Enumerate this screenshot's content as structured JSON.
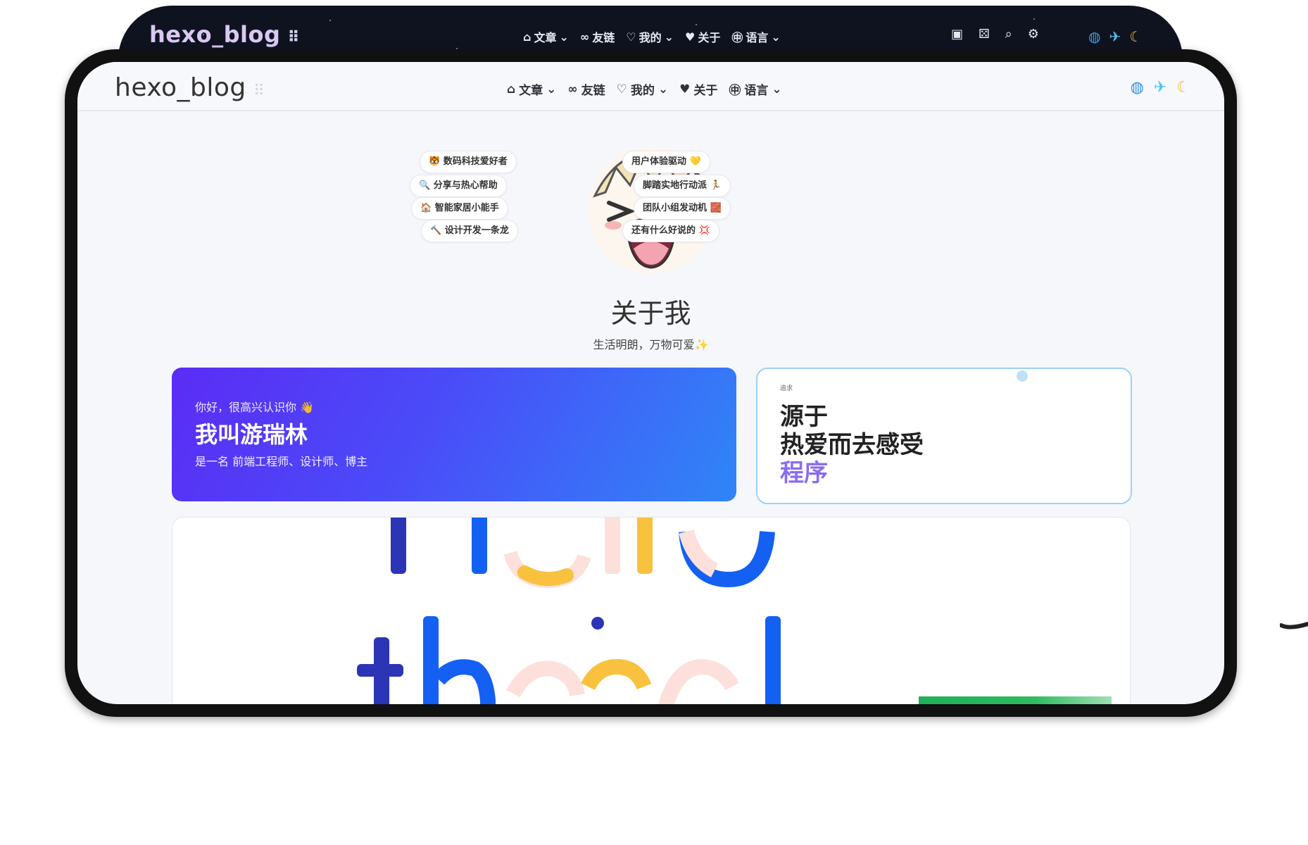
{
  "back_window": {
    "site_title": "hexo_blog",
    "menu": [
      {
        "icon": "home-icon",
        "glyph": "⌂",
        "label": "文章",
        "has_dropdown": true
      },
      {
        "icon": "link-icon",
        "glyph": "∞",
        "label": "友链",
        "has_dropdown": false
      },
      {
        "icon": "heart-pulse-icon",
        "glyph": "♡",
        "label": "我的",
        "has_dropdown": true
      },
      {
        "icon": "heart-icon",
        "glyph": "♥",
        "label": "关于",
        "has_dropdown": false
      },
      {
        "icon": "language-icon",
        "glyph": "㊥",
        "label": "语言",
        "has_dropdown": true
      }
    ]
  },
  "topbar": {
    "site_title": "hexo_blog",
    "menu": [
      {
        "icon": "home-icon",
        "glyph": "⌂",
        "label": "文章",
        "has_dropdown": true
      },
      {
        "icon": "link-icon",
        "glyph": "∞",
        "label": "友链",
        "has_dropdown": false
      },
      {
        "icon": "heart-pulse-icon",
        "glyph": "♡",
        "label": "我的",
        "has_dropdown": true
      },
      {
        "icon": "heart-icon",
        "glyph": "♥",
        "label": "关于",
        "has_dropdown": false
      },
      {
        "icon": "language-icon",
        "glyph": "㊥",
        "label": "语言",
        "has_dropdown": true
      }
    ],
    "mood_icons": [
      "globe-icon",
      "airplane-icon",
      "moon-icon"
    ]
  },
  "about": {
    "tags_left": [
      "数码科技爱好者",
      "分享与热心帮助",
      "智能家居小能手",
      "设计开发一条龙"
    ],
    "tags_right": [
      "用户体验驱动",
      "脚踏实地行动派",
      "团队小组发动机",
      "还有什么好说的"
    ],
    "title": "关于我",
    "subtitle": "生活明朗，万物可爱"
  },
  "hello_card": {
    "greeting": "你好，很高兴认识你",
    "name": "我叫游瑞林",
    "description": "是一名 前端工程师、设计师、博主"
  },
  "pursue_card": {
    "small_label": "追求",
    "line1": "源于",
    "line2": "热爱而去感受",
    "line3": "程序"
  },
  "colors": {
    "hello_gradient_start": "#5b2cf5",
    "hello_gradient_end": "#2f86f7",
    "accent_purple": "#8a6cf1",
    "dark_bg": "#0f1320",
    "device_frame": "#111111"
  }
}
